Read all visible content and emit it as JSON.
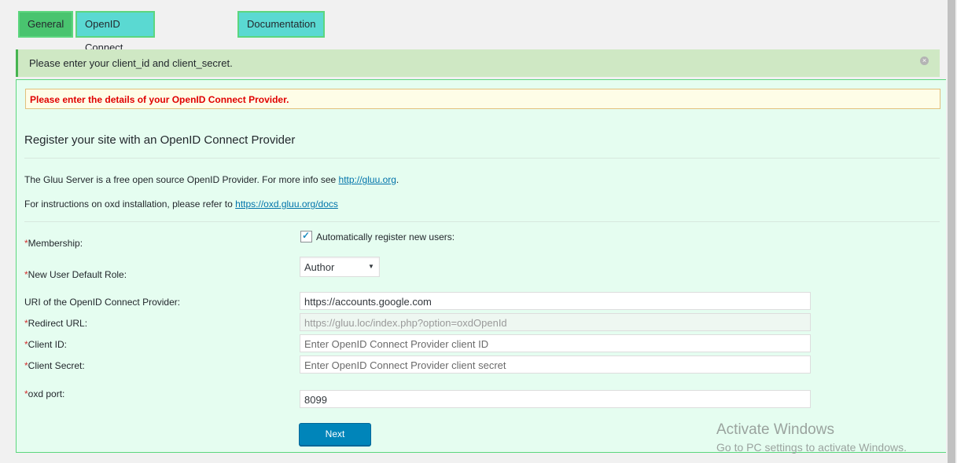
{
  "tabs": [
    {
      "label": "General",
      "active": true
    },
    {
      "label": "OpenID Connect Configuration",
      "active": false
    },
    {
      "label": "Documentation",
      "active": false
    }
  ],
  "notice": {
    "text": "Please enter your client_id and client_secret.",
    "dismiss_icon": "×"
  },
  "warning": {
    "text": "Please enter the details of your OpenID Connect Provider."
  },
  "section": {
    "title": "Register your site with an OpenID Connect Provider",
    "info1_prefix": "The Gluu Server is a free open source OpenID Provider. For more info see ",
    "info1_link": "http://gluu.org",
    "info1_suffix": ".",
    "info2_prefix": "For instructions on oxd installation, please refer to ",
    "info2_link": "https://oxd.gluu.org/docs"
  },
  "form": {
    "required_mark": "*",
    "membership_label": "Membership:",
    "membership_checkbox_label": "Automatically register new users:",
    "membership_checked": true,
    "role_label": "New User Default Role:",
    "role_value": "Author",
    "uri_label": "URI of the OpenID Connect Provider:",
    "uri_value": "https://accounts.google.com",
    "redirect_label": "Redirect URL:",
    "redirect_value": "https://gluu.loc/index.php?option=oxdOpenId",
    "client_id_label": "Client ID:",
    "client_id_placeholder": "Enter OpenID Connect Provider client ID",
    "client_secret_label": "Client Secret:",
    "client_secret_placeholder": "Enter OpenID Connect Provider client secret",
    "port_label": "oxd port:",
    "port_value": "8099",
    "next_label": "Next"
  },
  "watermark": {
    "title": "Activate Windows",
    "subtitle": "Go to PC settings to activate Windows."
  },
  "colors": {
    "tab_active": "#49c46f",
    "tab_inactive": "#5ad9d2",
    "panel_bg": "#e5fdf0",
    "warning_text": "#e00000",
    "button": "#0085ba"
  }
}
